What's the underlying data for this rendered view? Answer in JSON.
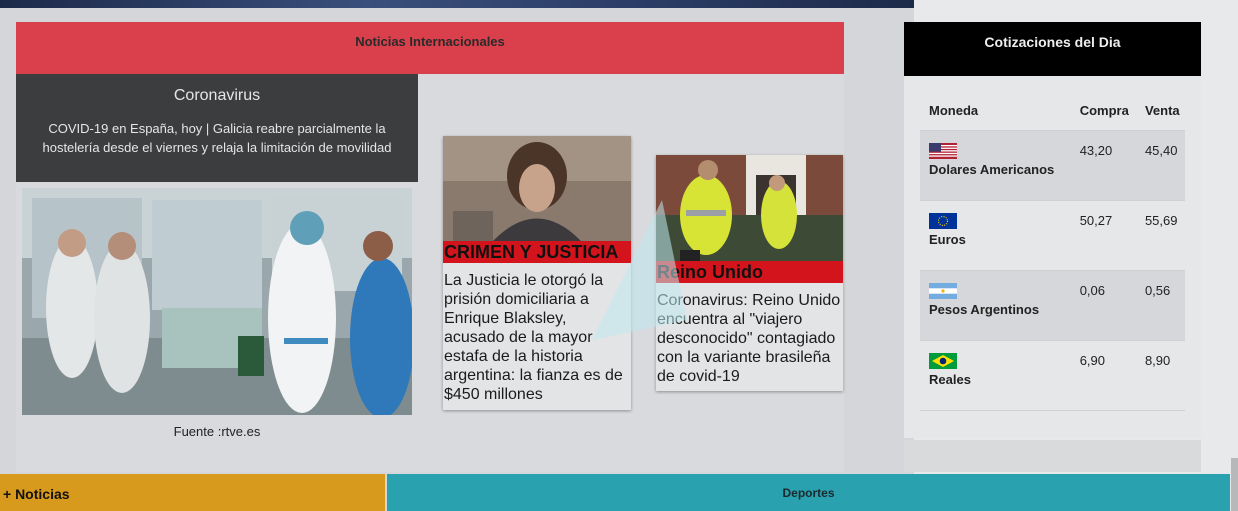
{
  "news": {
    "header": "Noticias Internacionales",
    "feature": {
      "title": "Coronavirus",
      "description": "COVID-19 en España, hoy | Galicia reabre parcialmente la hostelería desde el viernes y relaja la limitación de movilidad",
      "source": "Fuente :rtve.es"
    },
    "cards": [
      {
        "category": "CRIMEN Y JUSTICIA",
        "text": "La Justicia le otorgó la prisión domiciliaria a Enrique Blaksley, acusado de la mayor estafa de la historia argentina: la fianza es de $450 millones"
      },
      {
        "category": "Reino Unido",
        "text": "Coronavirus: Reino Unido encuentra al \"viajero desconocido\" contagiado con la variante brasileña de covid-19"
      }
    ]
  },
  "quotes": {
    "header": "Cotizaciones del Dia",
    "columns": [
      "Moneda",
      "Compra",
      "Venta"
    ],
    "rows": [
      {
        "name": "Dolares Americanos",
        "flag": "us-flag-icon",
        "buy": "43,20",
        "sell": "45,40"
      },
      {
        "name": "Euros",
        "flag": "eu-flag-icon",
        "buy": "50,27",
        "sell": "55,69"
      },
      {
        "name": "Pesos Argentinos",
        "flag": "ar-flag-icon",
        "buy": "0,06",
        "sell": "0,56"
      },
      {
        "name": "Reales",
        "flag": "br-flag-icon",
        "buy": "6,90",
        "sell": "8,90"
      }
    ]
  },
  "bottom": {
    "more_label": "+ Noticias",
    "sports_label": "Deportes"
  },
  "colors": {
    "news_header": "#d9404b",
    "category_red": "#d4141c",
    "more_button": "#d89a1c",
    "sports_button": "#2aa1ae"
  }
}
